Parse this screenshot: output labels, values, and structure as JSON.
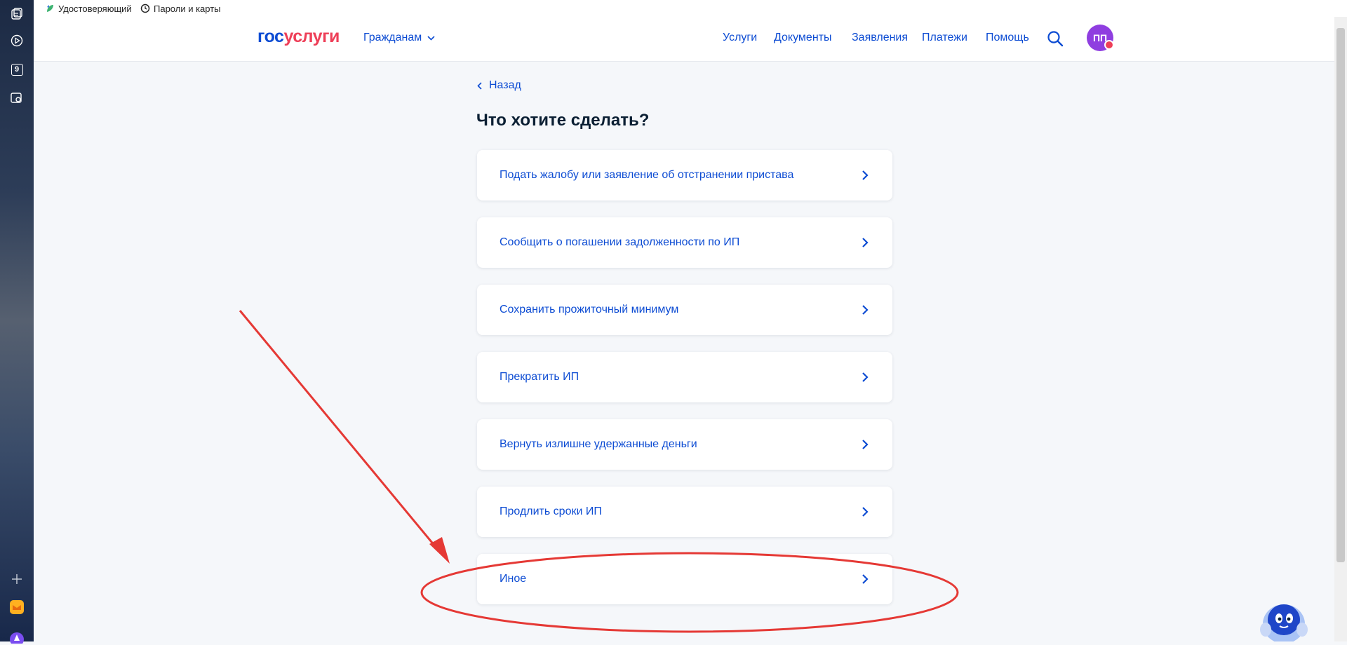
{
  "bookmarks": [
    {
      "label": "Удостоверяющий"
    },
    {
      "label": "Пароли и карты"
    }
  ],
  "sidebar_icons": [
    "notes-icon",
    "play-icon",
    "nine-icon",
    "screenshot-icon",
    "plus-icon",
    "mail-icon",
    "alice-icon"
  ],
  "sidebar": {
    "nine_label": "9"
  },
  "header": {
    "logo_part1": "гос",
    "logo_part2": "услуги",
    "citizens_menu": "Гражданам",
    "nav": [
      "Услуги",
      "Документы",
      "Заявления",
      "Платежи",
      "Помощь"
    ],
    "avatar_initials": "ПП"
  },
  "main": {
    "back_label": "Назад",
    "title": "Что хотите сделать?",
    "options": [
      "Подать жалобу или заявление об отстранении пристава",
      "Сообщить о погашении задолженности по ИП",
      "Сохранить прожиточный минимум",
      "Прекратить ИП",
      "Вернуть излишне удержанные деньги",
      "Продлить сроки ИП",
      "Иное"
    ]
  },
  "colors": {
    "brand_blue": "#0d4cd3",
    "brand_red": "#ee3f58",
    "annotation_red": "#e53935",
    "avatar_purple": "#8f3ee0",
    "page_bg": "#f5f7fa"
  }
}
